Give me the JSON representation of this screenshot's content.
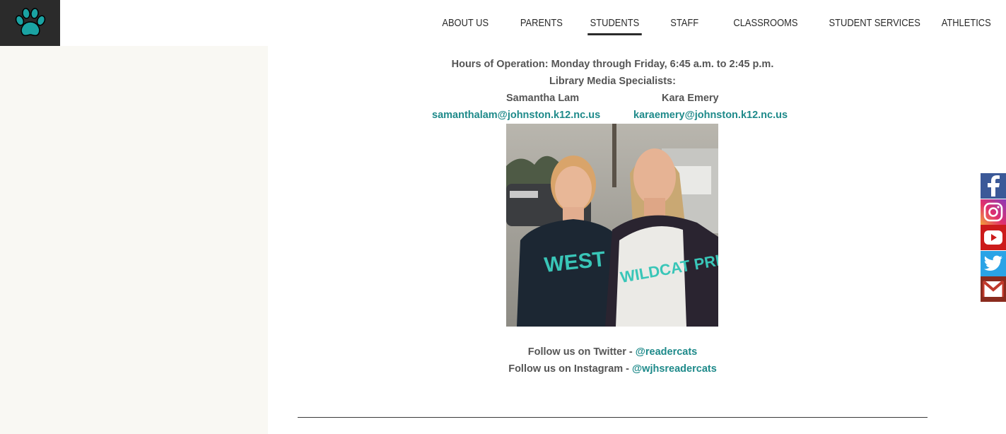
{
  "nav": {
    "items": [
      {
        "label": "ABOUT US"
      },
      {
        "label": "PARENTS"
      },
      {
        "label": "STUDENTS",
        "active": true
      },
      {
        "label": "STAFF"
      },
      {
        "label": "CLASSROOMS"
      },
      {
        "label": "STUDENT SERVICES"
      },
      {
        "label": "ATHLETICS"
      }
    ]
  },
  "content": {
    "hours": "Hours of Operation: Monday through Friday, 6:45 a.m. to 2:45 p.m.",
    "specialists_heading": "Library Media Specialists:",
    "specialists": [
      {
        "name": "Samantha Lam",
        "email": "samanthalam@johnston.k12.nc.us"
      },
      {
        "name": "Kara Emery",
        "email": "karaemery@johnston.k12.nc.us"
      }
    ],
    "twitter_prefix": "Follow us on Twitter - ",
    "twitter_handle": "@readercats",
    "instagram_prefix": "Follow us on Instagram - ",
    "instagram_handle": "@wjhsreadercats",
    "shirt_left_text": "WEST J PRIDE",
    "shirt_right_text": "WILDCAT PRIDE"
  },
  "social": [
    "facebook-icon",
    "instagram-icon",
    "youtube-icon",
    "twitter-icon",
    "gmail-icon"
  ],
  "colors": {
    "accent": "#1e8a8a",
    "logo_bg": "#2b2b2b",
    "left_panel": "#f9f8f3"
  }
}
